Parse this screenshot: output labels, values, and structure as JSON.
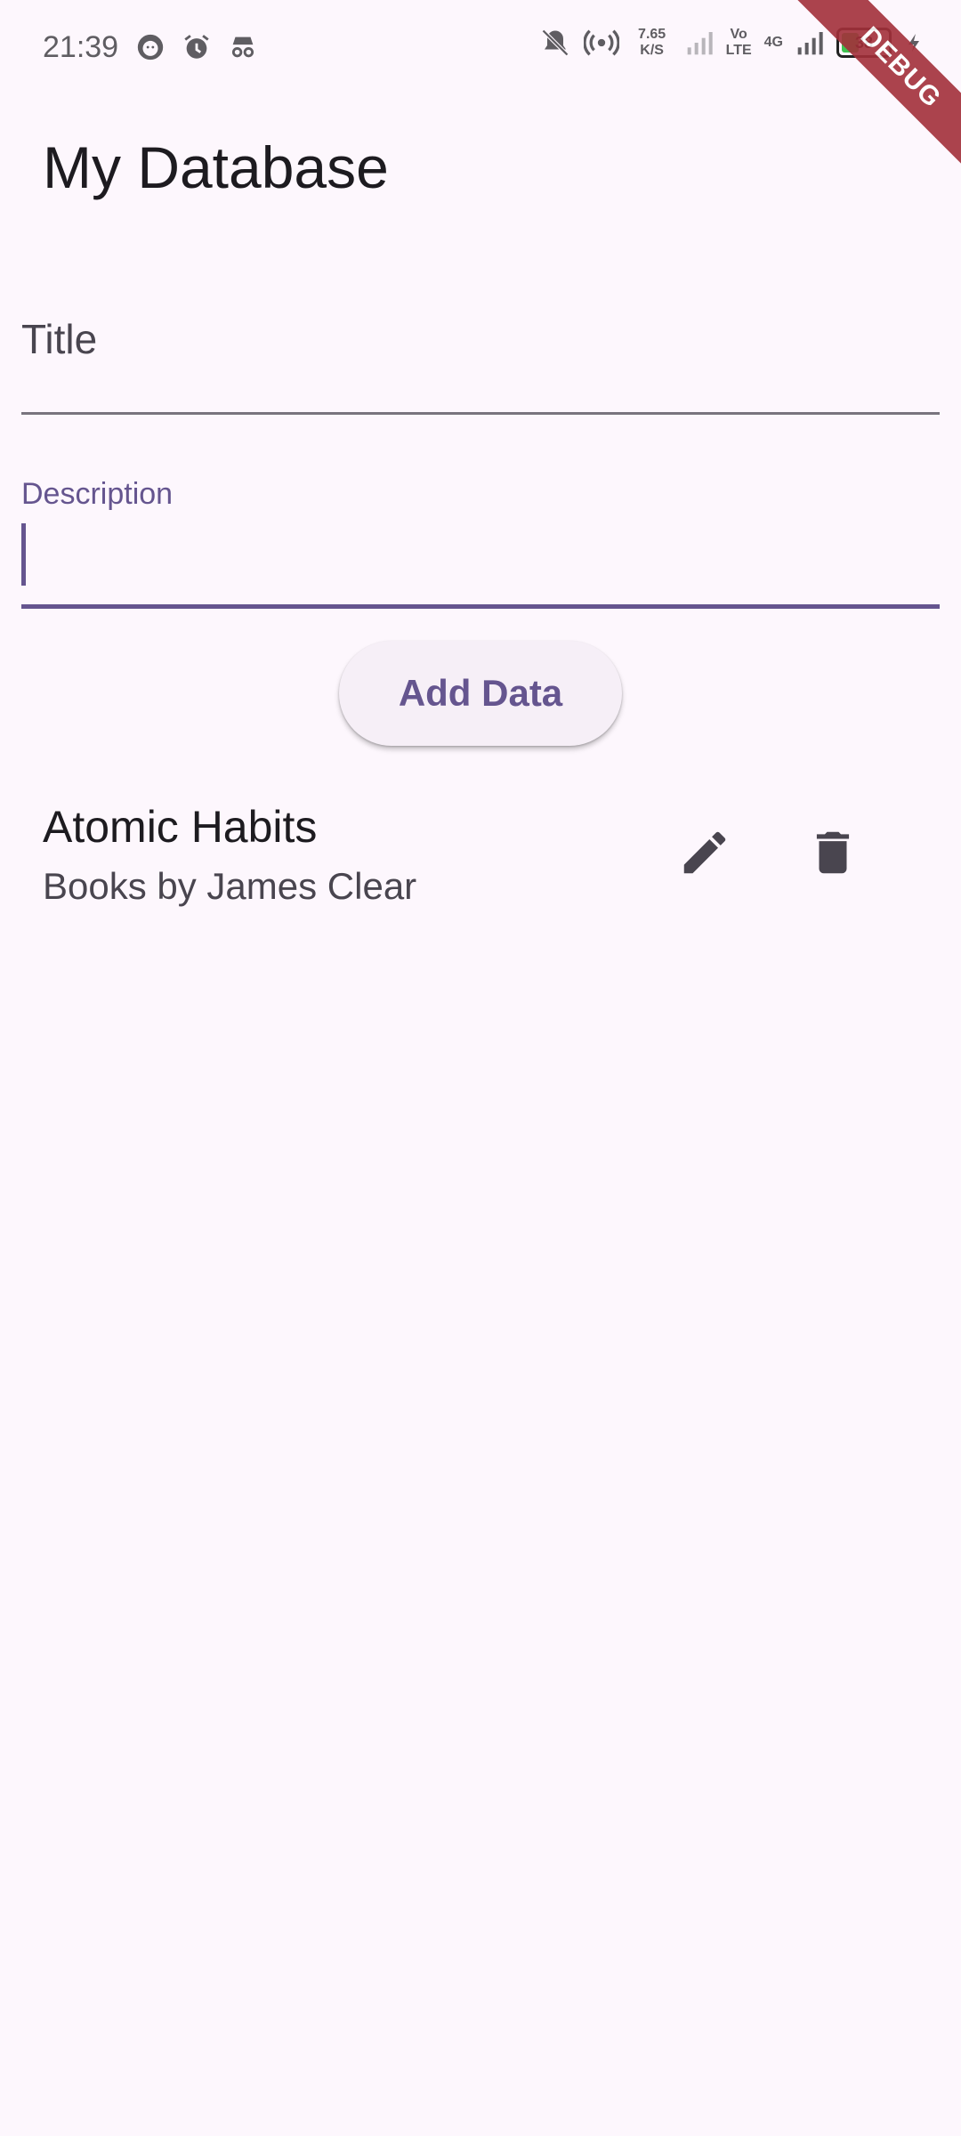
{
  "status_bar": {
    "time": "21:39",
    "net_speed_value": "7.65",
    "net_speed_unit": "K/S",
    "volte_top": "Vo",
    "volte_bottom": "LTE",
    "network": "4G",
    "battery_level": "38",
    "left_icons": [
      "face-icon",
      "alarm-icon",
      "incognito-icon"
    ],
    "right_icons": [
      "bell-off-icon",
      "hotspot-icon",
      "signal-icon",
      "signal-icon",
      "battery-icon",
      "charging-icon"
    ]
  },
  "debug_banner": "DEBUG",
  "app_bar": {
    "title": "My Database"
  },
  "form": {
    "title_label": "Title",
    "title_value": "",
    "description_label": "Description",
    "description_value": "",
    "add_button_label": "Add Data"
  },
  "items": [
    {
      "title": "Atomic Habits",
      "subtitle": "Books by James Clear"
    }
  ],
  "colors": {
    "background": "#fdf7fd",
    "primary": "#65558f",
    "icon": "#49454f",
    "ribbon": "#a3303a"
  }
}
